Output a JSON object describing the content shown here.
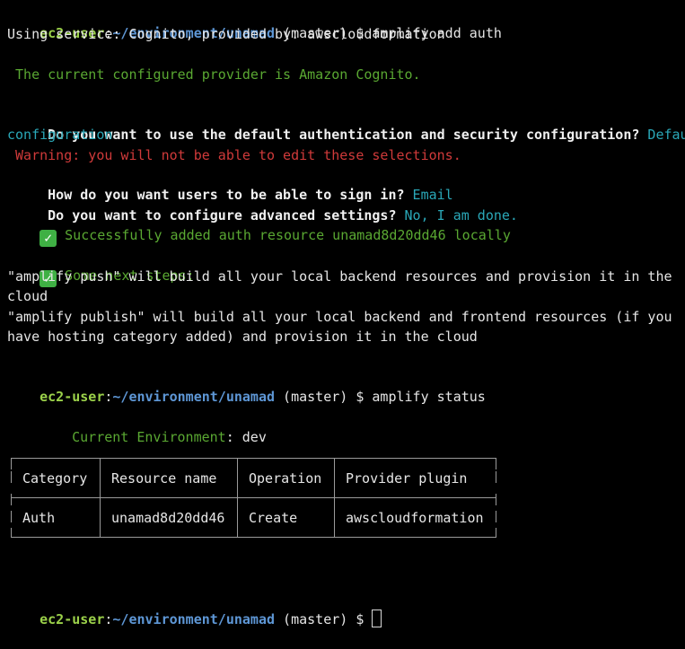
{
  "prompt": {
    "user": "ec2-user",
    "path": "~/environment/unamad",
    "branch": " (master) $ "
  },
  "commands": {
    "first": "amplify add auth",
    "second": "amplify status"
  },
  "output": {
    "using_service": "Using service: Cognito, provided by: awscloudformation",
    "current_provider": " The current configured provider is Amazon Cognito.",
    "q_default": " Do you want to use the default authentication and security configuration?",
    "a_default_1": " Default",
    "a_default_2": "configuration",
    "warning": " Warning: you will not be able to edit these selections.",
    "q_signin": " How do you want users to be able to sign in?",
    "a_signin": " Email",
    "q_advanced": " Do you want to configure advanced settings?",
    "a_advanced": " No, I am done.",
    "success": " Successfully added auth resource unamad8d20dd46 locally",
    "next_steps": " Some next steps:",
    "push_1": "\"amplify push\" will build all your local backend resources and provision it in the",
    "push_2": "cloud",
    "publish_1": "\"amplify publish\" will build all your local backend and frontend resources (if you",
    "publish_2": "have hosting category added) and provision it in the cloud"
  },
  "status": {
    "env_label": "Current Environment",
    "env_value": ": dev",
    "headers": [
      "Category",
      "Resource name",
      "Operation",
      "Provider plugin"
    ],
    "rows": [
      [
        "Auth",
        "unamad8d20dd46",
        "Create",
        "awscloudformation"
      ]
    ]
  },
  "icons": {
    "check": "check-mark-button-icon"
  },
  "colors": {
    "background": "#000000",
    "prompt_user": "#9bd14a",
    "prompt_path": "#5e97d6",
    "info_green": "#5aa832",
    "answer_cyan": "#2aa8b8",
    "warning_red": "#d03a3a"
  }
}
